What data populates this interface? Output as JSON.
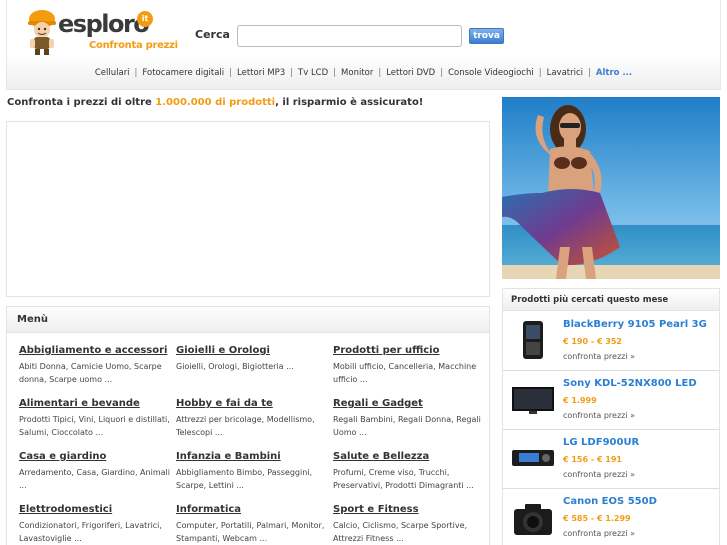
{
  "header": {
    "logo_text": "esploro",
    "logo_tld": "it",
    "logo_tagline": "Confronta prezzi",
    "search_label": "Cerca",
    "search_value": "",
    "search_button": "trova"
  },
  "nav": {
    "items": [
      "Cellulari",
      "Fotocamere digitali",
      "Lettori MP3",
      "Tv LCD",
      "Monitor",
      "Lettori DVD",
      "Console Videogiochi",
      "Lavatrici"
    ],
    "more": "Altro ..."
  },
  "promo": {
    "before": "Confronta i prezzi di oltre ",
    "highlight": "1.000.000 di prodotti",
    "after": ", il risparmio è assicurato!"
  },
  "menu": {
    "title": "Menù",
    "categories": [
      {
        "title": "Abbigliamento e accessori",
        "subs": [
          "Abiti Donna",
          "Camicie Uomo",
          "Scarpe donna",
          "Scarpe uomo"
        ],
        "ellipsis": "..."
      },
      {
        "title": "Gioielli e Orologi",
        "subs": [
          "Gioielli",
          "Orologi",
          "Bigiotteria"
        ],
        "ellipsis": "..."
      },
      {
        "title": "Prodotti per ufficio",
        "subs": [
          "Mobili ufficio",
          "Cancelleria",
          "Macchine ufficio"
        ],
        "ellipsis": "..."
      },
      {
        "title": "Alimentari e bevande",
        "subs": [
          "Prodotti Tipici",
          "Vini",
          "Liquori e distillati",
          "Salumi",
          "Cioccolato"
        ],
        "ellipsis": "..."
      },
      {
        "title": "Hobby e fai da te",
        "subs": [
          "Attrezzi per bricolage",
          "Modellismo",
          "Telescopi"
        ],
        "ellipsis": "..."
      },
      {
        "title": "Regali e Gadget",
        "subs": [
          "Regali Bambini",
          "Regali Donna",
          "Regali Uomo"
        ],
        "ellipsis": "..."
      },
      {
        "title": "Casa e giardino",
        "subs": [
          "Arredamento",
          "Casa",
          "Giardino",
          "Animali"
        ],
        "ellipsis": "..."
      },
      {
        "title": "Infanzia e Bambini",
        "subs": [
          "Abbigliamento Bimbo",
          "Passeggini",
          "Scarpe",
          "Lettini"
        ],
        "ellipsis": "..."
      },
      {
        "title": "Salute e Bellezza",
        "subs": [
          "Profumi",
          "Creme viso",
          "Trucchi",
          "Preservativi",
          "Prodotti Dimagranti"
        ],
        "ellipsis": "..."
      },
      {
        "title": "Elettrodomestici",
        "subs": [
          "Condizionatori",
          "Frigoriferi",
          "Lavatrici",
          "Lavastoviglie"
        ],
        "ellipsis": "..."
      },
      {
        "title": "Informatica",
        "subs": [
          "Computer",
          "Portatili",
          "Palmari",
          "Monitor",
          "Stampanti",
          "Webcam"
        ],
        "ellipsis": "..."
      },
      {
        "title": "Sport e Fitness",
        "subs": [
          "Calcio",
          "Ciclismo",
          "Scarpe Sportive",
          "Attrezzi Fitness"
        ],
        "ellipsis": "..."
      }
    ]
  },
  "products": {
    "title": "Prodotti più cercati questo mese",
    "items": [
      {
        "name": "BlackBerry 9105 Pearl 3G",
        "price": "€ 190 - € 352",
        "link": "confronta prezzi »",
        "icon": "smartphone-icon"
      },
      {
        "name": "Sony KDL-52NX800 LED",
        "price": "€ 1.999",
        "link": "confronta prezzi »",
        "icon": "tv-icon"
      },
      {
        "name": "LG LDF900UR",
        "price": "€ 156 - € 191",
        "link": "confronta prezzi »",
        "icon": "car-stereo-icon"
      },
      {
        "name": "Canon EOS 550D",
        "price": "€ 585 - € 1.299",
        "link": "confronta prezzi »",
        "icon": "camera-icon"
      }
    ]
  },
  "colors": {
    "accent_orange": "#f39c12",
    "link_blue": "#2a7fd4",
    "button_blue": "#3b7fd1",
    "border": "#e3e3e3"
  }
}
